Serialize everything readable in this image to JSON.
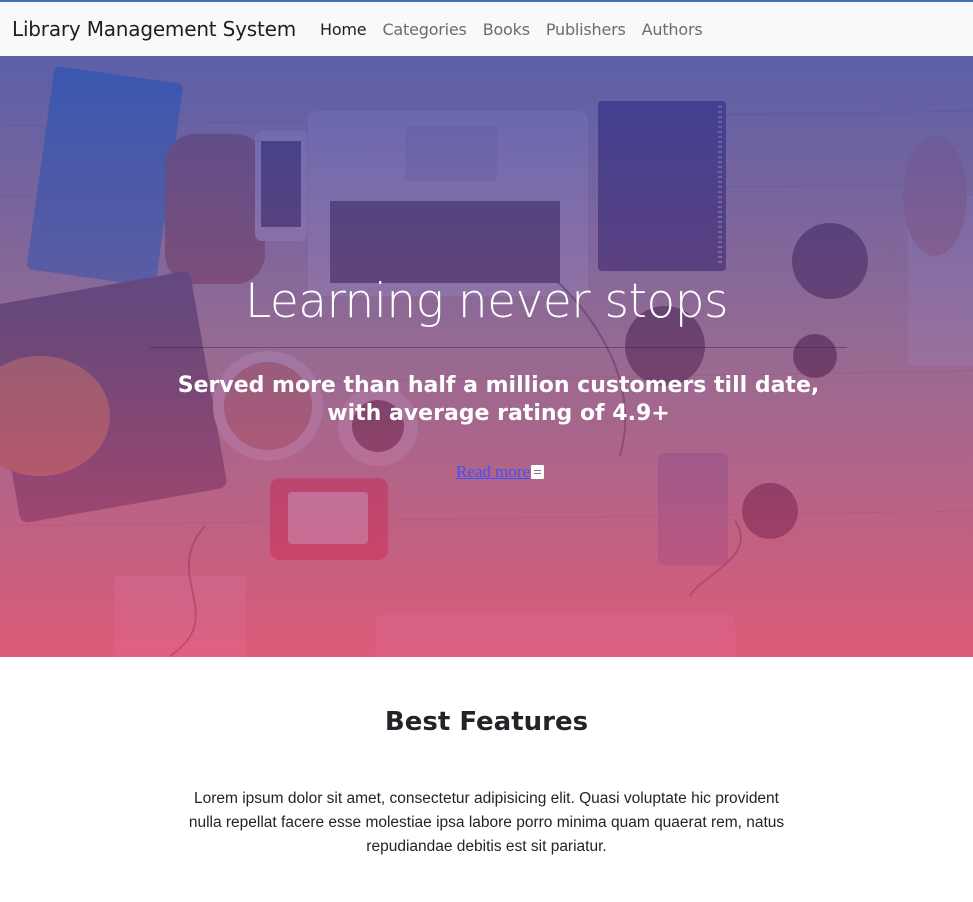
{
  "navbar": {
    "brand": "Library Management System",
    "links": [
      "Home",
      "Categories",
      "Books",
      "Publishers",
      "Authors"
    ]
  },
  "hero": {
    "title": "Learning never stops",
    "subtitle": "Served more than half a million customers till date, with average rating of 4.9+",
    "link_label": "Read more",
    "link_icon": "book-icon"
  },
  "features": {
    "heading": "Best Features",
    "text": "Lorem ipsum dolor sit amet, consectetur adipisicing elit. Quasi voluptate hic provident nulla repellat facere esse molestiae ipsa labore porro minima quam quaerat rem, natus repudiandae debitis est sit pariatur."
  },
  "colors": {
    "hero_overlay_top": "#4048a8",
    "hero_overlay_bottom": "#e1466e",
    "link": "#3b54ff"
  }
}
